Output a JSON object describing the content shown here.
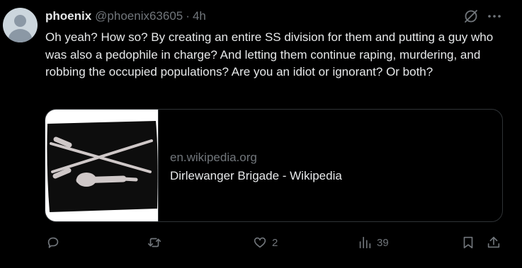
{
  "post": {
    "author_name": "phoenix",
    "handle": "@phoenix63605",
    "separator": "·",
    "time": "4h",
    "text": "Oh yeah? How so? By creating an entire SS division for them and putting a guy who was also a pedophile in charge? And letting them continue raping, murdering, and robbing the occupied populations? Are you an idiot or ignorant? Or both?"
  },
  "link_card": {
    "domain": "en.wikipedia.org",
    "title": "Dirlewanger Brigade - Wikipedia",
    "thumbnail": "crossed-rifles-and-grenade-patch"
  },
  "actions": {
    "reply": {
      "icon": "reply-icon",
      "count": ""
    },
    "repost": {
      "icon": "repost-icon",
      "count": ""
    },
    "like": {
      "icon": "heart-icon",
      "count": "2"
    },
    "views": {
      "icon": "views-icon",
      "count": "39"
    },
    "bookmark": {
      "icon": "bookmark-icon"
    },
    "share": {
      "icon": "share-icon"
    }
  },
  "colors": {
    "background": "#000000",
    "text_primary": "#e7e9ea",
    "text_secondary": "#71767b",
    "border": "#2f3336"
  }
}
